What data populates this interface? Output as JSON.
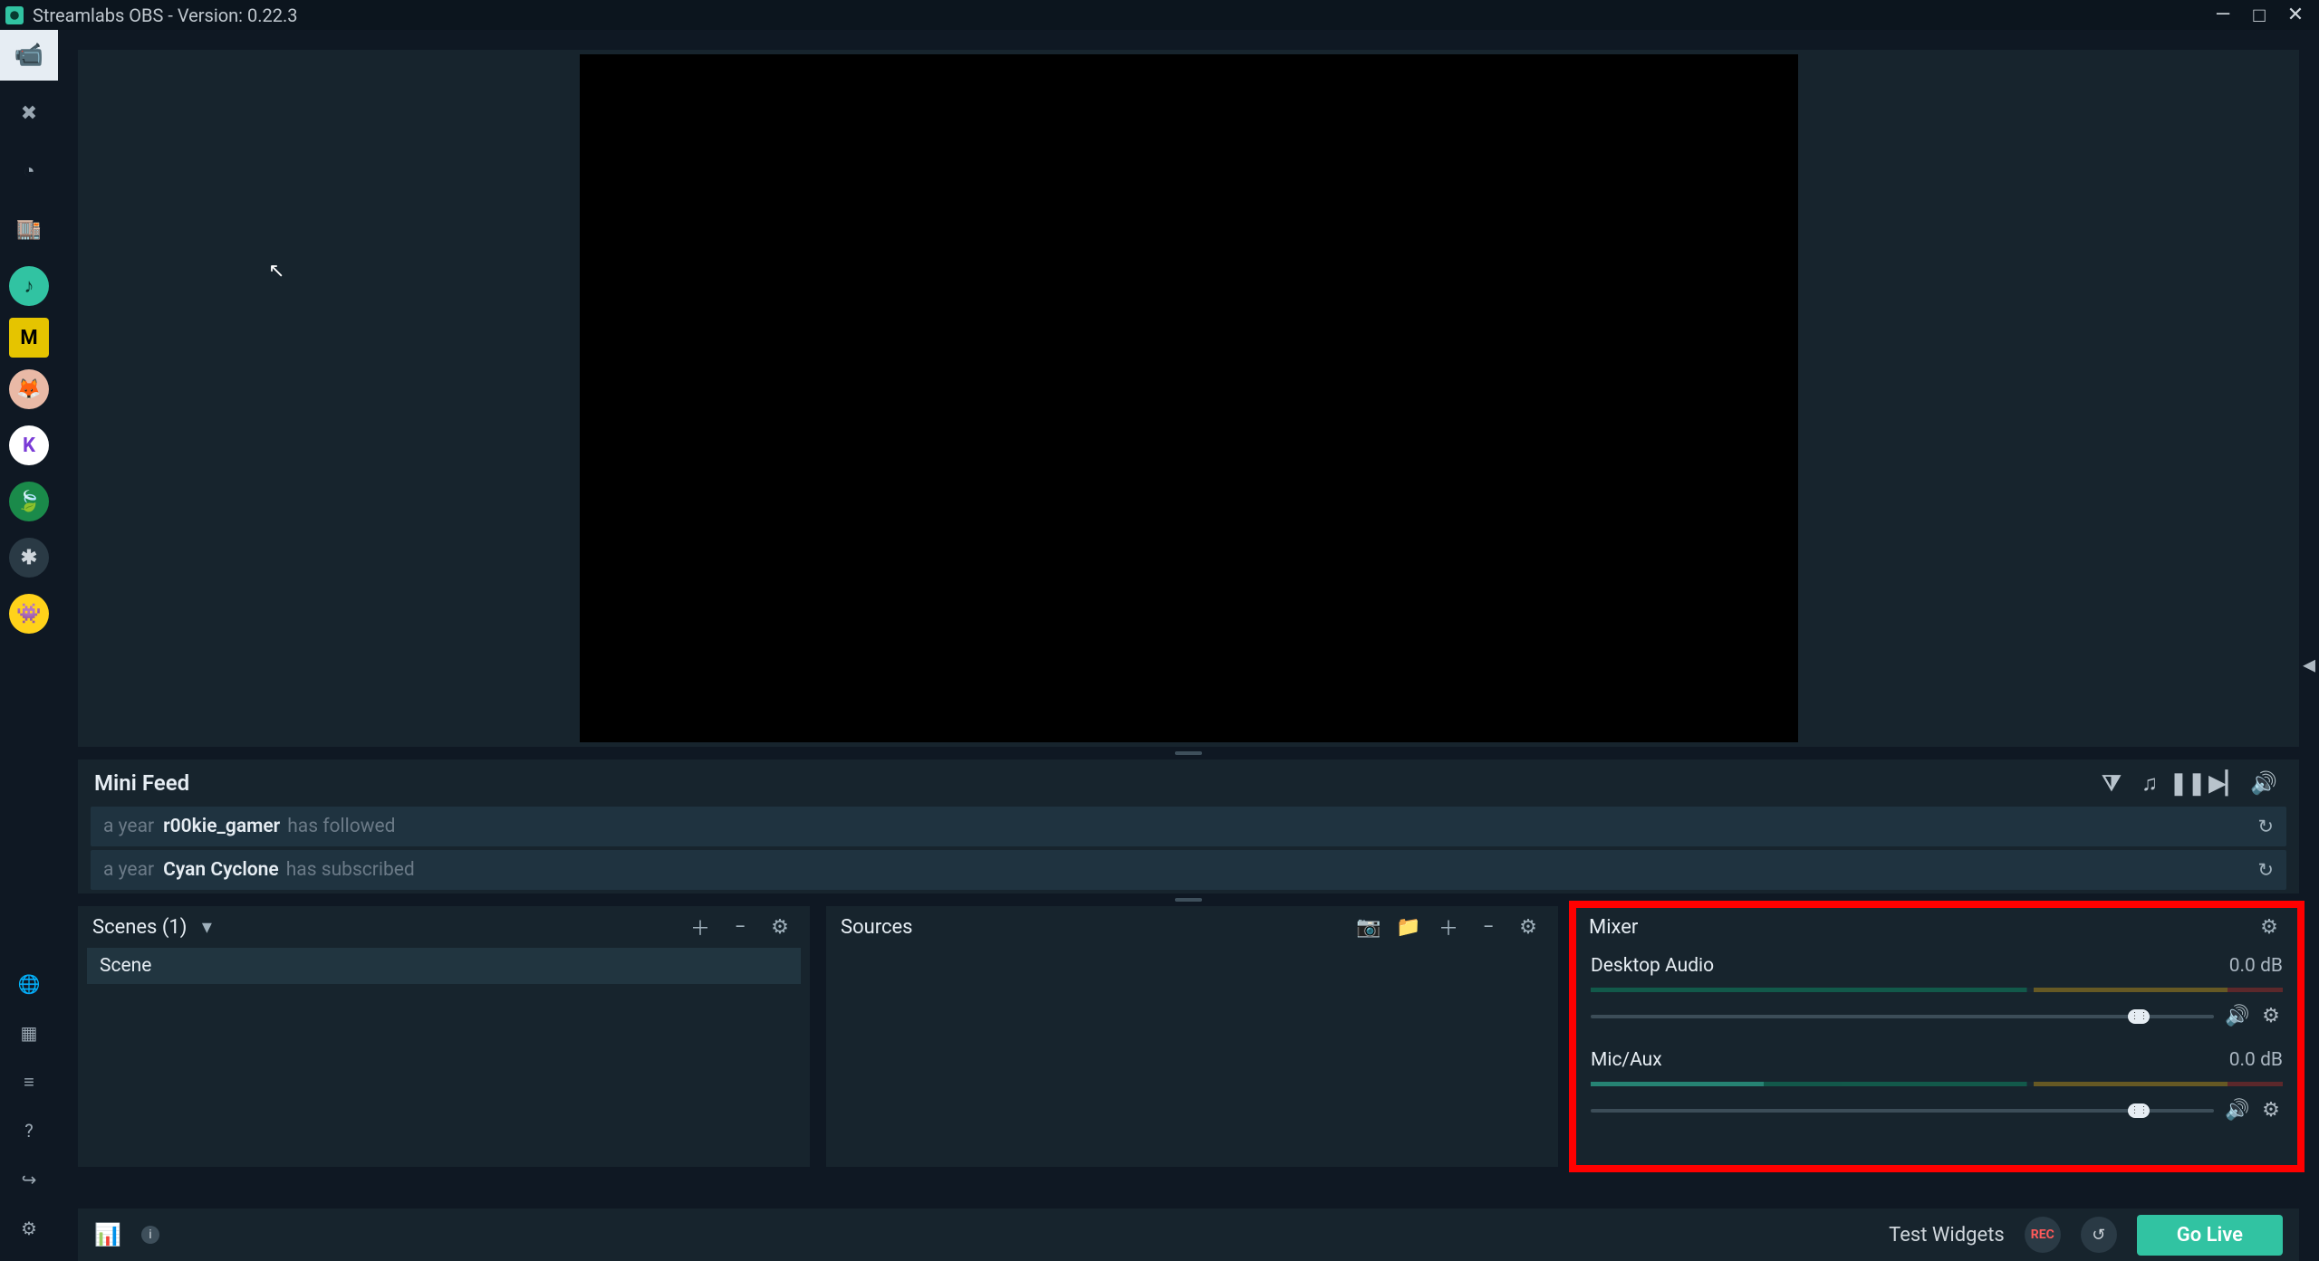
{
  "window": {
    "title": "Streamlabs OBS - Version: 0.22.3",
    "minimize": "—",
    "maximize": "□",
    "close": "✕"
  },
  "sidebar": {
    "top": [
      {
        "icon": "editor-icon",
        "glyph": "📹"
      },
      {
        "icon": "themes-icon",
        "glyph": "✖"
      },
      {
        "icon": "chat-icon",
        "glyph": "◔"
      },
      {
        "icon": "store-icon",
        "glyph": "🏬"
      }
    ],
    "apps": [
      {
        "name": "app-loop",
        "bg": "#31c3a2",
        "fg": "#0b2a22",
        "glyph": "♪"
      },
      {
        "name": "app-m",
        "bg": "#e5c400",
        "fg": "#000",
        "glyph": "M",
        "square": true
      },
      {
        "name": "app-fox",
        "bg": "#e9b9a6",
        "fg": "#7a3a2a",
        "glyph": "🦊"
      },
      {
        "name": "app-k",
        "bg": "#ffffff",
        "fg": "#7a3bd6",
        "glyph": "K"
      },
      {
        "name": "app-leaf",
        "bg": "#1a8a4a",
        "fg": "#fff",
        "glyph": "🍃"
      },
      {
        "name": "app-puzzle",
        "bg": "#2a3a45",
        "fg": "#cfd6dc",
        "glyph": "✱"
      },
      {
        "name": "app-monster",
        "bg": "#ffd21a",
        "fg": "#6a2abf",
        "glyph": "👾"
      }
    ],
    "bottom": [
      {
        "icon": "globe-icon",
        "glyph": "🌐"
      },
      {
        "icon": "grid-icon",
        "glyph": "▦"
      },
      {
        "icon": "bars-icon",
        "glyph": "≡"
      },
      {
        "icon": "help-icon",
        "glyph": "?"
      },
      {
        "icon": "logout-icon",
        "glyph": "↪"
      },
      {
        "icon": "settings-icon",
        "glyph": "⚙"
      }
    ]
  },
  "mini_feed": {
    "title": "Mini Feed",
    "rows": [
      {
        "time": "a year",
        "user": "r00kie_gamer",
        "action": "has followed"
      },
      {
        "time": "a year",
        "user": "Cyan Cyclone",
        "action": "has subscribed"
      }
    ]
  },
  "scenes": {
    "title": "Scenes (1)",
    "items": [
      {
        "label": "Scene"
      }
    ]
  },
  "sources": {
    "title": "Sources"
  },
  "mixer": {
    "title": "Mixer",
    "items": [
      {
        "name": "Desktop Audio",
        "level": "0.0 dB",
        "live_pct": 0,
        "thumb_pct": 88
      },
      {
        "name": "Mic/Aux",
        "level": "0.0 dB",
        "live_pct": 25,
        "thumb_pct": 88
      }
    ]
  },
  "footer": {
    "test_widgets": "Test Widgets",
    "rec": "REC",
    "go_live": "Go Live"
  }
}
